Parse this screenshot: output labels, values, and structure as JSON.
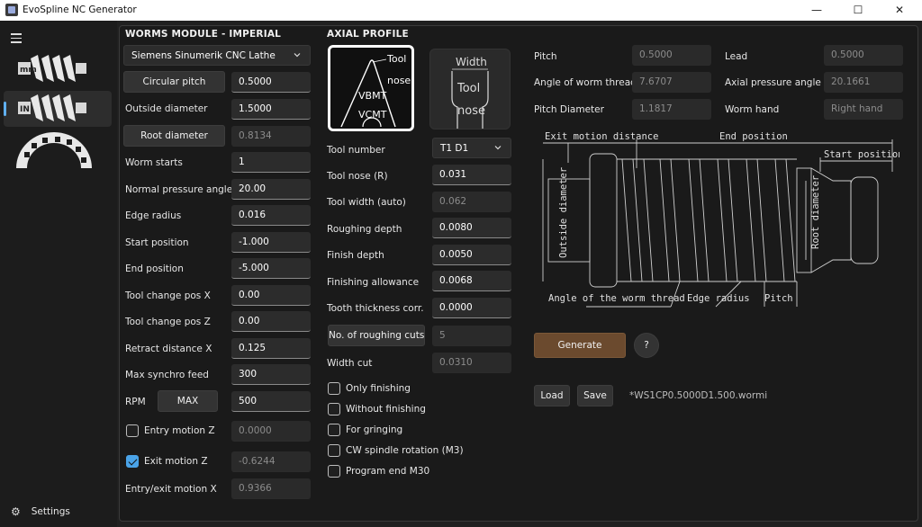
{
  "window": {
    "title": "EvoSpline NC Generator",
    "minimize_glyph": "—",
    "maximize_glyph": "☐",
    "close_glyph": "✕"
  },
  "sidebar": {
    "settings_label": "Settings",
    "nav_items": [
      {
        "icon": "worm-icon",
        "active": false
      },
      {
        "icon": "worm-selected-icon",
        "active": true
      },
      {
        "icon": "spline-gear-icon",
        "active": false
      }
    ]
  },
  "worms": {
    "title": "WORMS MODULE - IMPERIAL",
    "machine": "Siemens Sinumerik CNC Lathe",
    "circular_pitch_label": "Circular pitch",
    "circular_pitch": "0.5000",
    "outside_diameter_label": "Outside diameter",
    "outside_diameter": "1.5000",
    "root_diameter_label": "Root diameter",
    "root_diameter": "0.8134",
    "worm_starts_label": "Worm starts",
    "worm_starts": "1",
    "normal_pressure_angle_label": "Normal pressure angle",
    "normal_pressure_angle": "20.00",
    "edge_radius_label": "Edge radius",
    "edge_radius": "0.016",
    "start_position_label": "Start position",
    "start_position": "-1.000",
    "end_position_label": "End position",
    "end_position": "-5.000",
    "tool_change_x_label": "Tool change pos X",
    "tool_change_x": "0.00",
    "tool_change_z_label": "Tool change pos Z",
    "tool_change_z": "0.00",
    "retract_distance_label": "Retract distance X",
    "retract_distance": "0.125",
    "max_synchro_feed_label": "Max synchro feed",
    "max_synchro_feed": "300",
    "rpm_label": "RPM",
    "rpm_max_button": "MAX",
    "rpm": "500",
    "entry_motion_label": "Entry motion Z",
    "entry_motion": "0.0000",
    "entry_motion_checked": false,
    "exit_motion_label": "Exit motion Z",
    "exit_motion": "-0.6244",
    "exit_motion_checked": true,
    "entry_exit_label": "Entry/exit motion X",
    "entry_exit": "0.9366"
  },
  "axial": {
    "title": "AXIAL PROFILE",
    "tool_card_1": {
      "tool": "Tool",
      "nose": "nose",
      "vbmt": "VBMT",
      "vcmt": "VCMT"
    },
    "tool_card_2": {
      "width": "Width",
      "tool": "Tool",
      "nose": "nose"
    },
    "tool_number_label": "Tool number",
    "tool_number": "T1 D1",
    "tool_nose_label": "Tool nose (R)",
    "tool_nose": "0.031",
    "tool_width_label": "Tool width (auto)",
    "tool_width": "0.062",
    "roughing_depth_label": "Roughing depth",
    "roughing_depth": "0.0080",
    "finish_depth_label": "Finish depth",
    "finish_depth": "0.0050",
    "finishing_allowance_label": "Finishing allowance",
    "finishing_allowance": "0.0068",
    "tooth_thickness_label": "Tooth thickness corr.",
    "tooth_thickness": "0.0000",
    "roughing_cuts_button": "No. of roughing cuts",
    "roughing_cuts": "5",
    "width_cut_label": "Width cut",
    "width_cut": "0.0310",
    "options": [
      {
        "label": "Only finishing",
        "checked": false
      },
      {
        "label": "Without finishing",
        "checked": false
      },
      {
        "label": "For gringing",
        "checked": false
      },
      {
        "label": "CW spindle rotation (M3)",
        "checked": false
      },
      {
        "label": "Program end M30",
        "checked": false
      }
    ]
  },
  "results": {
    "pitch_label": "Pitch",
    "pitch": "0.5000",
    "lead_label": "Lead",
    "lead": "0.5000",
    "angle_label": "Angle of worm thread",
    "angle": "7.6707",
    "axial_pressure_label": "Axial pressure angle",
    "axial_pressure": "20.1661",
    "pitch_diameter_label": "Pitch Diameter",
    "pitch_diameter": "1.1817",
    "worm_hand_label": "Worm hand",
    "worm_hand": "Right hand"
  },
  "diagram": {
    "exit_motion": "Exit motion distance",
    "end_position": "End position",
    "start_position": "Start position",
    "outside_diameter": "Outside diameter",
    "root_diameter": "Root diameter",
    "angle": "Angle of the worm thread",
    "edge_radius": "Edge radius",
    "pitch": "Pitch"
  },
  "actions": {
    "generate": "Generate",
    "help": "?",
    "load": "Load",
    "save": "Save",
    "filename": "*WS1CP0.5000D1.500.wormi"
  }
}
